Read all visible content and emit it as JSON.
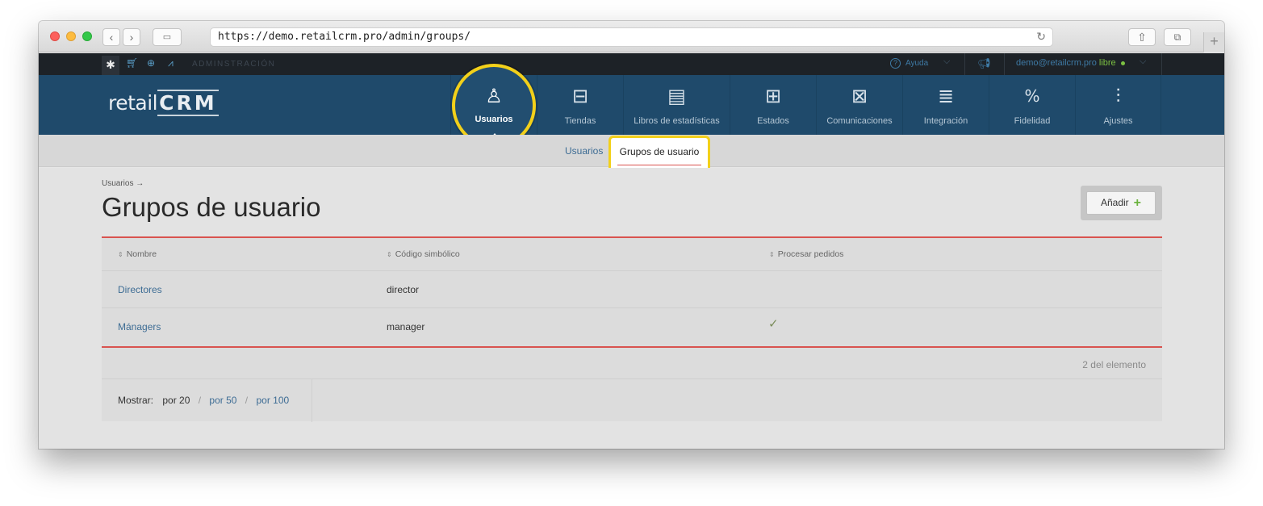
{
  "browser": {
    "url": "https://demo.retailcrm.pro/admin/groups/"
  },
  "topbar": {
    "section_label": "ADMINSTRACIÓN",
    "help_label": "Ayuda",
    "account_email": "demo@retailcrm.pro",
    "account_plan": "libre"
  },
  "logo": {
    "prefix": "retail",
    "brand": "CRM"
  },
  "nav": {
    "items": [
      {
        "label": "Usuarios",
        "icon": "user-icon"
      },
      {
        "label": "Tiendas",
        "icon": "store-icon"
      },
      {
        "label": "Libros de estadísticas",
        "icon": "book-icon"
      },
      {
        "label": "Estados",
        "icon": "grid-icon"
      },
      {
        "label": "Comunicaciones",
        "icon": "mail-icon"
      },
      {
        "label": "Integración",
        "icon": "lines-icon"
      },
      {
        "label": "Fidelidad",
        "icon": "percent-tag-icon"
      },
      {
        "label": "Ajustes",
        "icon": "sliders-icon"
      }
    ],
    "active": "Usuarios"
  },
  "subnav": {
    "link": "Usuarios",
    "active": "Grupos de usuario"
  },
  "page": {
    "breadcrumb": "Usuarios →",
    "title": "Grupos de usuario",
    "add_label": "Añadir"
  },
  "table": {
    "columns": [
      "Nombre",
      "Código simbólico",
      "Procesar pedidos"
    ],
    "rows": [
      {
        "name": "Directores",
        "code": "director",
        "process": false
      },
      {
        "name": "Mánagers",
        "code": "manager",
        "process": true
      }
    ],
    "count_label": "2 del elemento"
  },
  "pagination": {
    "label": "Mostrar:",
    "current": "por 20",
    "options": [
      "por 50",
      "por 100"
    ]
  },
  "colors": {
    "header_bg": "#1f4a6b",
    "topbar_bg": "#1d2227",
    "highlight": "#f2d01a",
    "accent_red": "#d9534f",
    "link": "#3d6c94"
  }
}
